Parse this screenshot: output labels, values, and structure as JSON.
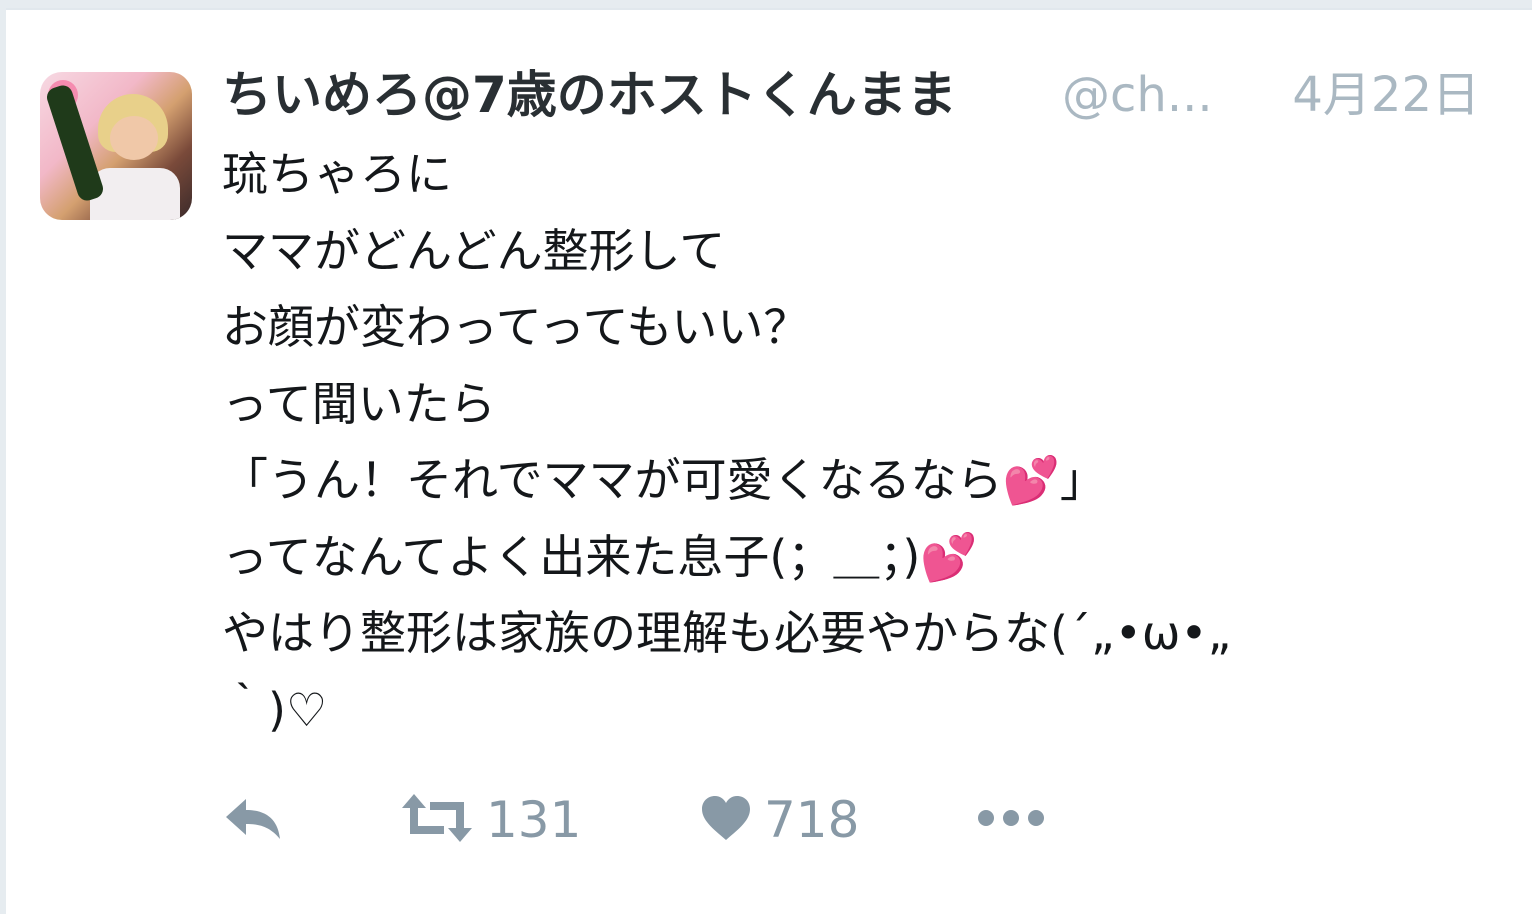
{
  "tweet": {
    "author_name": "ちいめろ@7歳のホストくんまま",
    "handle": "@ch...",
    "date": "4月22日",
    "lines": [
      "琉ちゃろに",
      "ママがどんどん整形して",
      "お顔が変わってってもいい？",
      "って聞いたら",
      "「うん！それでママが可愛くなるなら",
      "」",
      "ってなんてよく出来た息子(；＿；)",
      "やはり整形は家族の理解も必要やからな(´„•ω•„",
      "｀)♡"
    ],
    "heart_emoji": "💕"
  },
  "actions": {
    "retweet_count": "131",
    "like_count": "718"
  },
  "icons": {
    "reply": "reply-icon",
    "retweet": "retweet-icon",
    "like": "heart-icon",
    "more": "more-icon"
  },
  "colors": {
    "text": "#14171a",
    "secondary": "#aab8c2",
    "action": "#8899a6",
    "heart_emoji": "#e0163a"
  }
}
